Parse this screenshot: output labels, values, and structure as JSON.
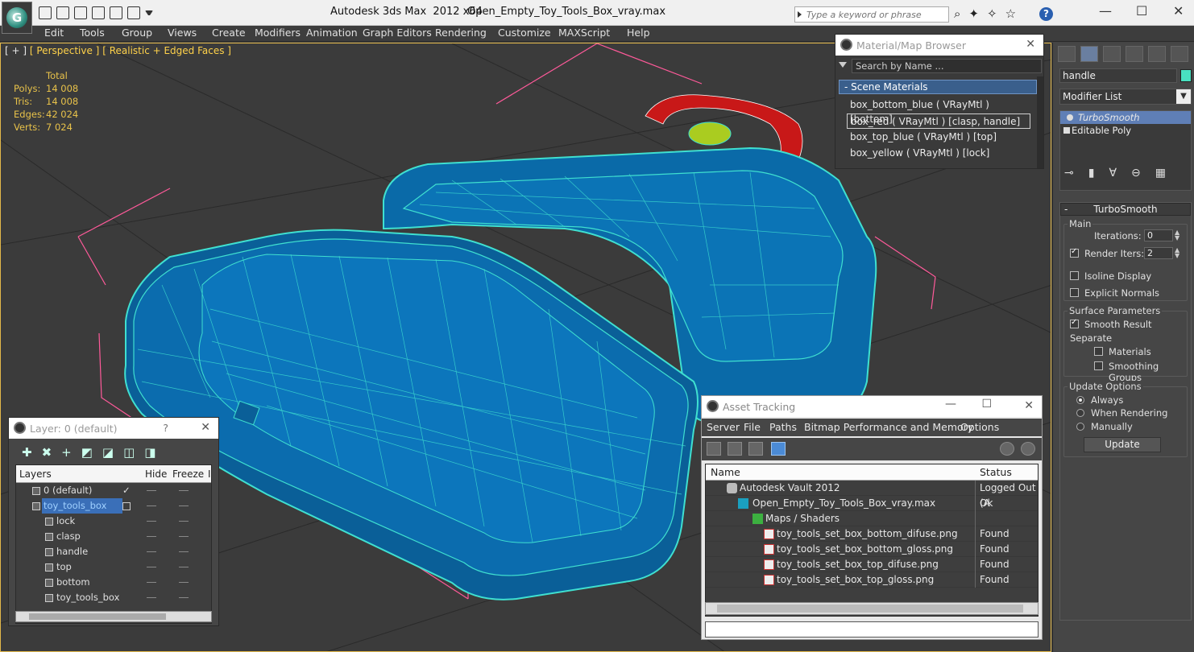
{
  "window": {
    "app_title": "Autodesk 3ds Max  2012 x64",
    "file_title": "Open_Empty_Toy_Tools_Box_vray.max",
    "search_placeholder": "Type a keyword or phrase",
    "help_label": "?",
    "minimize": "—",
    "maximize": "☐",
    "close": "✕"
  },
  "menu": [
    "Edit",
    "Tools",
    "Group",
    "Views",
    "Create",
    "Modifiers",
    "Animation",
    "Graph Editors",
    "Rendering",
    "Customize",
    "MAXScript",
    "Help"
  ],
  "viewport": {
    "label_plus": "[ + ]",
    "label_view": "[ Perspective ]",
    "label_shading": "[ Realistic + Edged Faces ]",
    "stats_header": "Total",
    "stats": [
      {
        "label": "Polys:",
        "value": "14 008"
      },
      {
        "label": "Tris:",
        "value": "14 008"
      },
      {
        "label": "Edges:",
        "value": "42 024"
      },
      {
        "label": "Verts:",
        "value": "7 024"
      }
    ],
    "colors": {
      "box_blue": "#0a6aa8",
      "wire": "#3fe0d0",
      "handle_red": "#c81818",
      "lock_yellow": "#c8c820",
      "bbox": "#ff5a9a"
    }
  },
  "material_browser": {
    "title": "Material/Map Browser",
    "search": "Search by Name ...",
    "section": "- Scene Materials",
    "items": [
      "box_bottom_blue  ( VRayMtl ) [bottom]",
      "box_red  ( VRayMtl ) [clasp, handle]",
      "box_top_blue  ( VRayMtl ) [top]",
      "box_yellow  ( VRayMtl ) [lock]"
    ]
  },
  "command_panel": {
    "object_name": "handle",
    "modifier_list": "Modifier List",
    "stack": [
      "TurboSmooth",
      "Editable Poly"
    ],
    "rollout_title": "TurboSmooth",
    "rollout_minus": "-",
    "main_group": "Main",
    "iterations_label": "Iterations:",
    "iterations_value": "0",
    "render_iters_label": "Render Iters:",
    "render_iters_value": "2",
    "isoline": "Isoline Display",
    "explicit_normals": "Explicit Normals",
    "surface_group": "Surface Parameters",
    "smooth_result": "Smooth Result",
    "separate": "Separate",
    "materials": "Materials",
    "smoothing_groups": "Smoothing Groups",
    "update_group": "Update Options",
    "always": "Always",
    "when_rendering": "When Rendering",
    "manually": "Manually",
    "update_button": "Update"
  },
  "layer_panel": {
    "title": "Layer: 0 (default)",
    "help": "?",
    "close": "✕",
    "columns": [
      "Layers",
      "Hide",
      "Freeze",
      "I"
    ],
    "rows": [
      {
        "name": "0 (default)",
        "indent": 0,
        "check": "✓"
      },
      {
        "name": "toy_tools_box",
        "indent": 0,
        "selected": true
      },
      {
        "name": "lock",
        "indent": 1
      },
      {
        "name": "clasp",
        "indent": 1
      },
      {
        "name": "handle",
        "indent": 1
      },
      {
        "name": "top",
        "indent": 1
      },
      {
        "name": "bottom",
        "indent": 1
      },
      {
        "name": "toy_tools_box",
        "indent": 1
      }
    ]
  },
  "asset_tracking": {
    "title": "Asset Tracking",
    "menu": [
      "Server",
      "File",
      "Paths",
      "Bitmap Performance and Memory",
      "Options"
    ],
    "columns": [
      "Name",
      "Status"
    ],
    "rows": [
      {
        "name": "Autodesk Vault 2012",
        "status": "Logged Out (A",
        "indent": 1
      },
      {
        "name": "Open_Empty_Toy_Tools_Box_vray.max",
        "status": "Ok",
        "indent": 2
      },
      {
        "name": "Maps / Shaders",
        "status": "",
        "indent": 3
      },
      {
        "name": "toy_tools_set_box_bottom_difuse.png",
        "status": "Found",
        "indent": 4
      },
      {
        "name": "toy_tools_set_box_bottom_gloss.png",
        "status": "Found",
        "indent": 4
      },
      {
        "name": "toy_tools_set_box_top_difuse.png",
        "status": "Found",
        "indent": 4
      },
      {
        "name": "toy_tools_set_box_top_gloss.png",
        "status": "Found",
        "indent": 4
      }
    ]
  }
}
